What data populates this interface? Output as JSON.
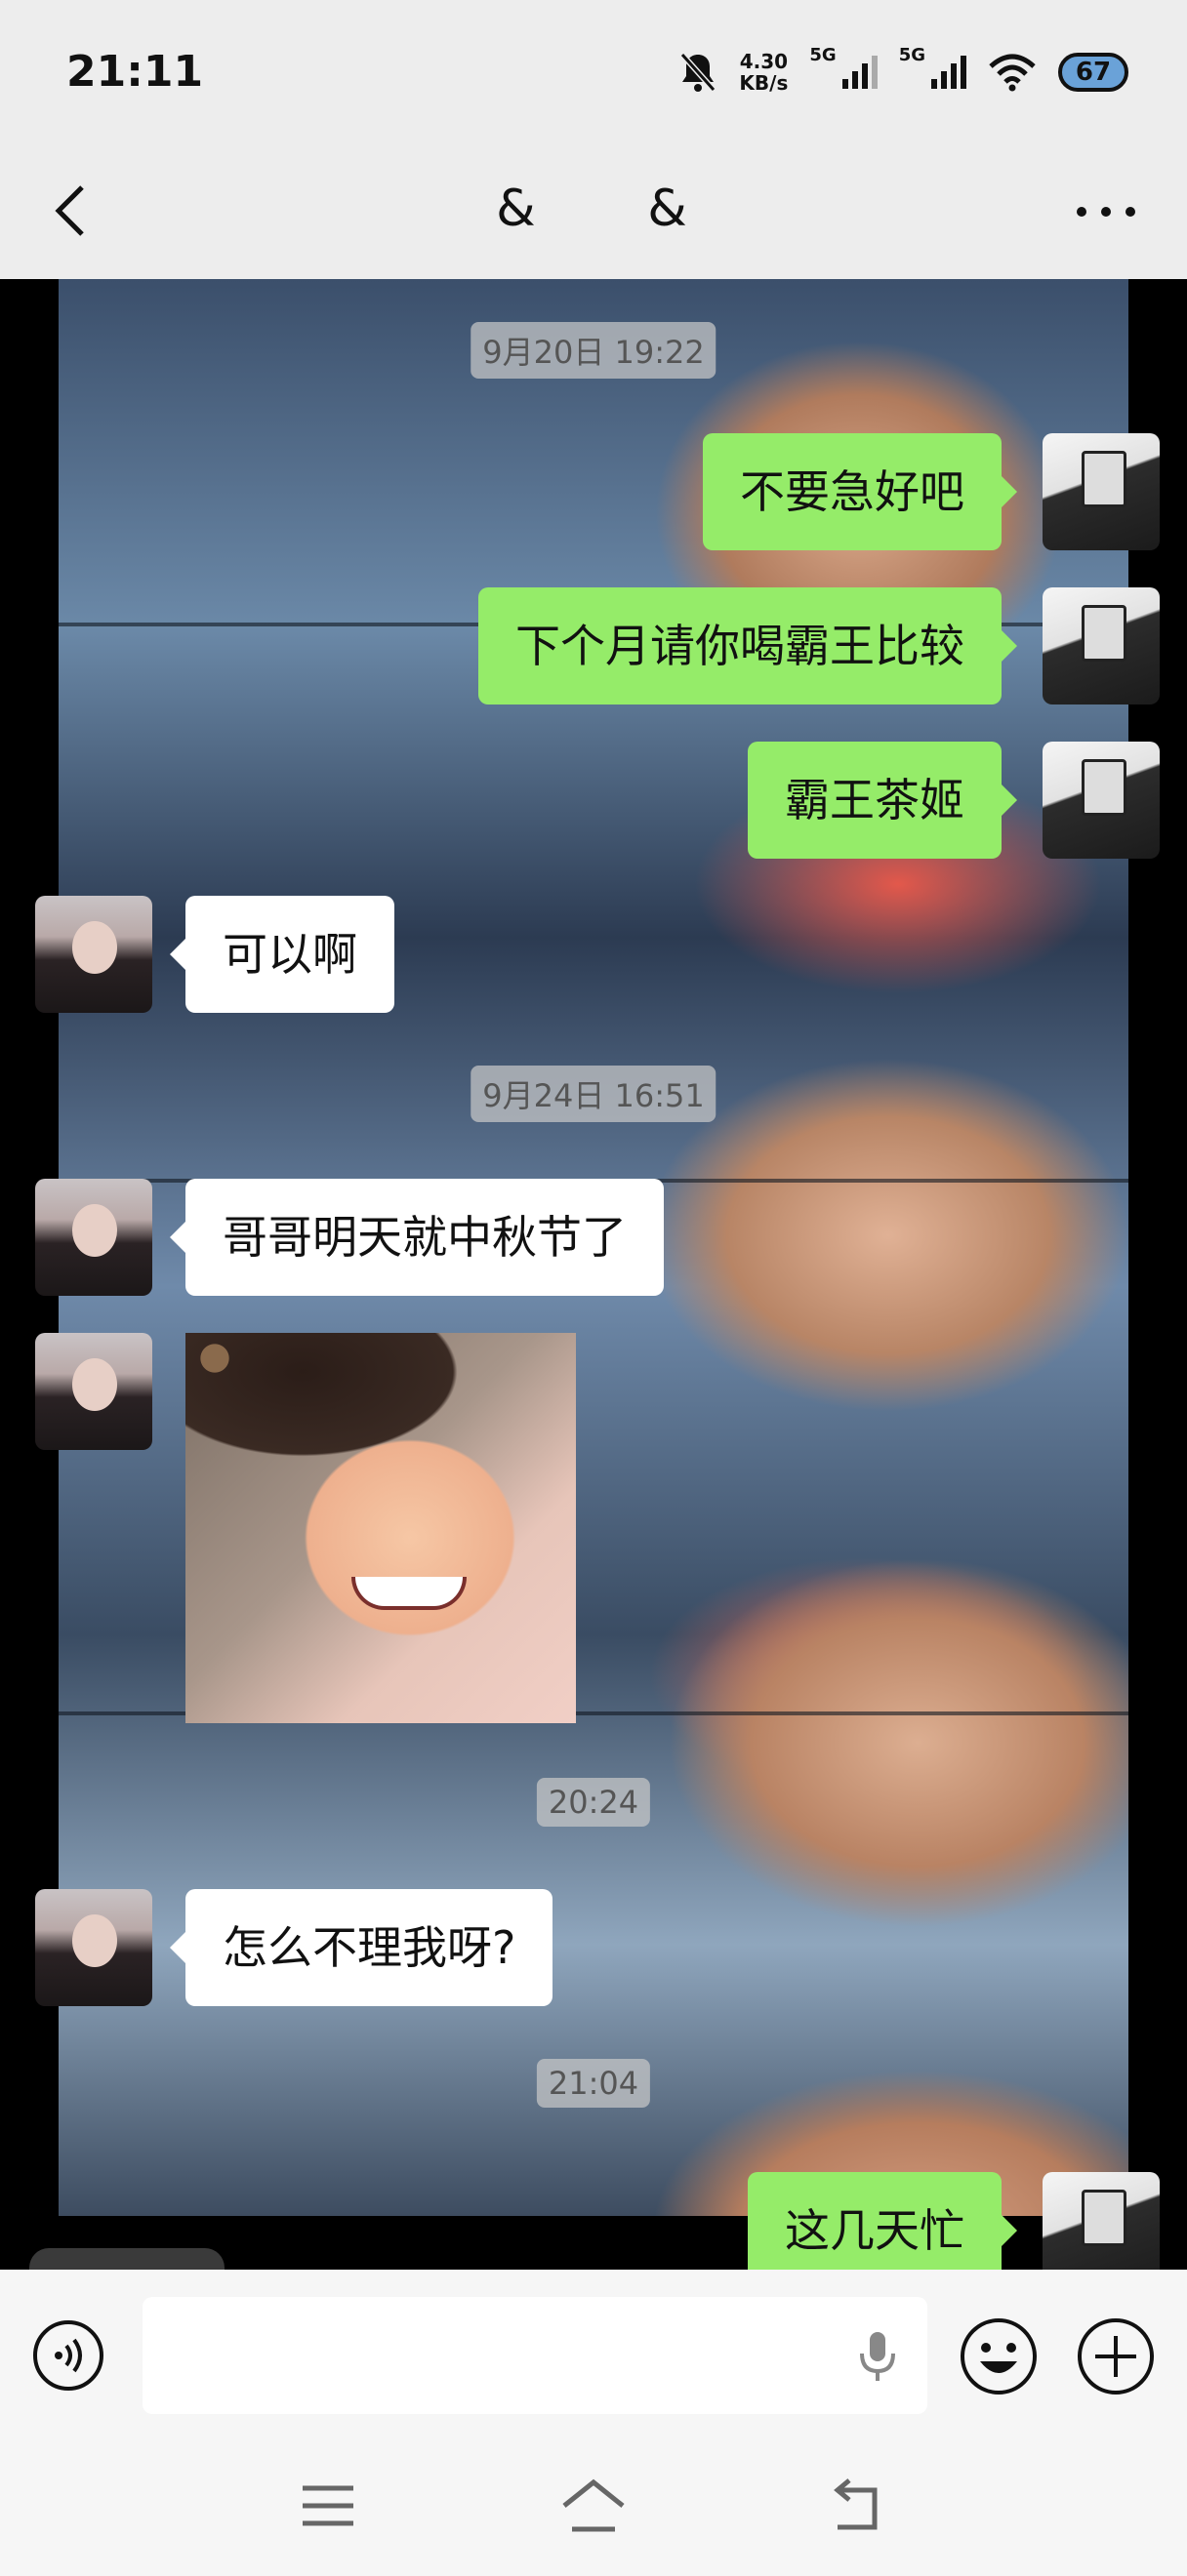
{
  "status_bar": {
    "time": "21:11",
    "net_speed_value": "4.30",
    "net_speed_unit": "KB/s",
    "sim1_label": "5G",
    "sim2_label": "5G",
    "battery": "67",
    "icons": [
      "mute-bell-icon",
      "signal-icon",
      "wifi-icon",
      "battery-icon"
    ]
  },
  "header": {
    "title": "& &",
    "back_icon": "chevron-left-icon",
    "more_icon": "more-dots-icon"
  },
  "chat": {
    "timestamps": [
      "9月20日 19:22",
      "9月24日 16:51",
      "20:24",
      "21:04"
    ],
    "messages": [
      {
        "from": "me",
        "text": "不要急好吧"
      },
      {
        "from": "me",
        "text": "下个月请你喝霸王比较"
      },
      {
        "from": "me",
        "text": "霸王茶姬"
      },
      {
        "from": "her",
        "text": "可以啊"
      },
      {
        "from": "her",
        "text": "哥哥明天就中秋节了"
      },
      {
        "from": "her",
        "text": "",
        "type": "sticker",
        "sticker": "laughing-child"
      },
      {
        "from": "her",
        "text": "怎么不理我呀?"
      },
      {
        "from": "me",
        "text": "这几天忙"
      }
    ]
  },
  "input_bar": {
    "voice_icon": "voice-icon",
    "mic_icon": "mic-icon",
    "emoji_icon": "emoji-icon",
    "plus_icon": "plus-icon",
    "text_value": ""
  },
  "nav_bar": {
    "icons": [
      "menu-icon",
      "home-icon",
      "back-icon"
    ]
  },
  "colors": {
    "my_bubble": "#95ec69",
    "her_bubble": "#ffffff",
    "chrome": "#ededed"
  }
}
